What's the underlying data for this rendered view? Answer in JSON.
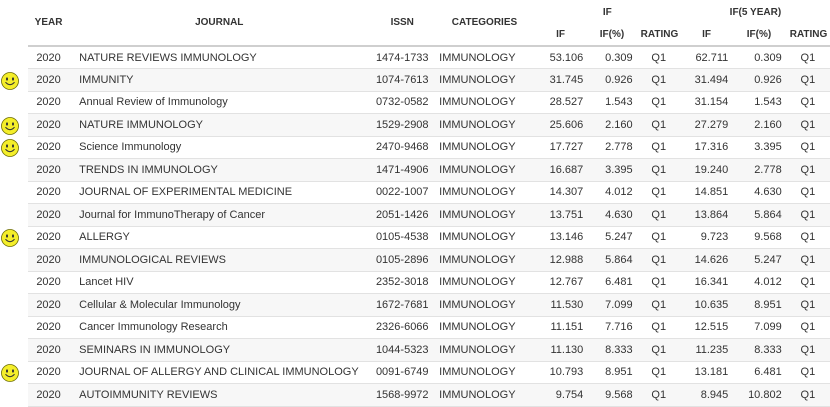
{
  "header": {
    "year": "YEAR",
    "journal": "JOURNAL",
    "issn": "ISSN",
    "categories": "CATEGORIES",
    "if_group": "IF",
    "if5_group": "IF(5 YEAR)",
    "if": "IF",
    "if_pct": "IF(%)",
    "rating": "RATING",
    "if5": "IF",
    "if5_pct": "IF(%)",
    "rating5": "RATING"
  },
  "colors": {
    "smiley_fill": "#f4ee2a",
    "smiley_stroke": "#6b6b00"
  },
  "rows": [
    {
      "year": "2020",
      "journal": "NATURE REVIEWS IMMUNOLOGY",
      "issn": "1474-1733",
      "category": "IMMUNOLOGY",
      "if": "53.106",
      "if_pct": "0.309",
      "rating": "Q1",
      "if5": "62.711",
      "if5_pct": "0.309",
      "rating5": "Q1",
      "smiley": false
    },
    {
      "year": "2020",
      "journal": "IMMUNITY",
      "issn": "1074-7613",
      "category": "IMMUNOLOGY",
      "if": "31.745",
      "if_pct": "0.926",
      "rating": "Q1",
      "if5": "31.494",
      "if5_pct": "0.926",
      "rating5": "Q1",
      "smiley": true
    },
    {
      "year": "2020",
      "journal": "Annual Review of Immunology",
      "issn": "0732-0582",
      "category": "IMMUNOLOGY",
      "if": "28.527",
      "if_pct": "1.543",
      "rating": "Q1",
      "if5": "31.154",
      "if5_pct": "1.543",
      "rating5": "Q1",
      "smiley": false
    },
    {
      "year": "2020",
      "journal": "NATURE IMMUNOLOGY",
      "issn": "1529-2908",
      "category": "IMMUNOLOGY",
      "if": "25.606",
      "if_pct": "2.160",
      "rating": "Q1",
      "if5": "27.279",
      "if5_pct": "2.160",
      "rating5": "Q1",
      "smiley": true
    },
    {
      "year": "2020",
      "journal": "Science Immunology",
      "issn": "2470-9468",
      "category": "IMMUNOLOGY",
      "if": "17.727",
      "if_pct": "2.778",
      "rating": "Q1",
      "if5": "17.316",
      "if5_pct": "3.395",
      "rating5": "Q1",
      "smiley": true
    },
    {
      "year": "2020",
      "journal": "TRENDS IN IMMUNOLOGY",
      "issn": "1471-4906",
      "category": "IMMUNOLOGY",
      "if": "16.687",
      "if_pct": "3.395",
      "rating": "Q1",
      "if5": "19.240",
      "if5_pct": "2.778",
      "rating5": "Q1",
      "smiley": false
    },
    {
      "year": "2020",
      "journal": "JOURNAL OF EXPERIMENTAL MEDICINE",
      "issn": "0022-1007",
      "category": "IMMUNOLOGY",
      "if": "14.307",
      "if_pct": "4.012",
      "rating": "Q1",
      "if5": "14.851",
      "if5_pct": "4.630",
      "rating5": "Q1",
      "smiley": false
    },
    {
      "year": "2020",
      "journal": "Journal for ImmunoTherapy of Cancer",
      "issn": "2051-1426",
      "category": "IMMUNOLOGY",
      "if": "13.751",
      "if_pct": "4.630",
      "rating": "Q1",
      "if5": "13.864",
      "if5_pct": "5.864",
      "rating5": "Q1",
      "smiley": false
    },
    {
      "year": "2020",
      "journal": "ALLERGY",
      "issn": "0105-4538",
      "category": "IMMUNOLOGY",
      "if": "13.146",
      "if_pct": "5.247",
      "rating": "Q1",
      "if5": "9.723",
      "if5_pct": "9.568",
      "rating5": "Q1",
      "smiley": true
    },
    {
      "year": "2020",
      "journal": "IMMUNOLOGICAL REVIEWS",
      "issn": "0105-2896",
      "category": "IMMUNOLOGY",
      "if": "12.988",
      "if_pct": "5.864",
      "rating": "Q1",
      "if5": "14.626",
      "if5_pct": "5.247",
      "rating5": "Q1",
      "smiley": false
    },
    {
      "year": "2020",
      "journal": "Lancet HIV",
      "issn": "2352-3018",
      "category": "IMMUNOLOGY",
      "if": "12.767",
      "if_pct": "6.481",
      "rating": "Q1",
      "if5": "16.341",
      "if5_pct": "4.012",
      "rating5": "Q1",
      "smiley": false
    },
    {
      "year": "2020",
      "journal": "Cellular & Molecular Immunology",
      "issn": "1672-7681",
      "category": "IMMUNOLOGY",
      "if": "11.530",
      "if_pct": "7.099",
      "rating": "Q1",
      "if5": "10.635",
      "if5_pct": "8.951",
      "rating5": "Q1",
      "smiley": false
    },
    {
      "year": "2020",
      "journal": "Cancer Immunology Research",
      "issn": "2326-6066",
      "category": "IMMUNOLOGY",
      "if": "11.151",
      "if_pct": "7.716",
      "rating": "Q1",
      "if5": "12.515",
      "if5_pct": "7.099",
      "rating5": "Q1",
      "smiley": false
    },
    {
      "year": "2020",
      "journal": "SEMINARS IN IMMUNOLOGY",
      "issn": "1044-5323",
      "category": "IMMUNOLOGY",
      "if": "11.130",
      "if_pct": "8.333",
      "rating": "Q1",
      "if5": "11.235",
      "if5_pct": "8.333",
      "rating5": "Q1",
      "smiley": false
    },
    {
      "year": "2020",
      "journal": "JOURNAL OF ALLERGY AND CLINICAL IMMUNOLOGY",
      "issn": "0091-6749",
      "category": "IMMUNOLOGY",
      "if": "10.793",
      "if_pct": "8.951",
      "rating": "Q1",
      "if5": "13.181",
      "if5_pct": "6.481",
      "rating5": "Q1",
      "smiley": true
    },
    {
      "year": "2020",
      "journal": "AUTOIMMUNITY REVIEWS",
      "issn": "1568-9972",
      "category": "IMMUNOLOGY",
      "if": "9.754",
      "if_pct": "9.568",
      "rating": "Q1",
      "if5": "8.945",
      "if5_pct": "10.802",
      "rating5": "Q1",
      "smiley": false
    }
  ]
}
